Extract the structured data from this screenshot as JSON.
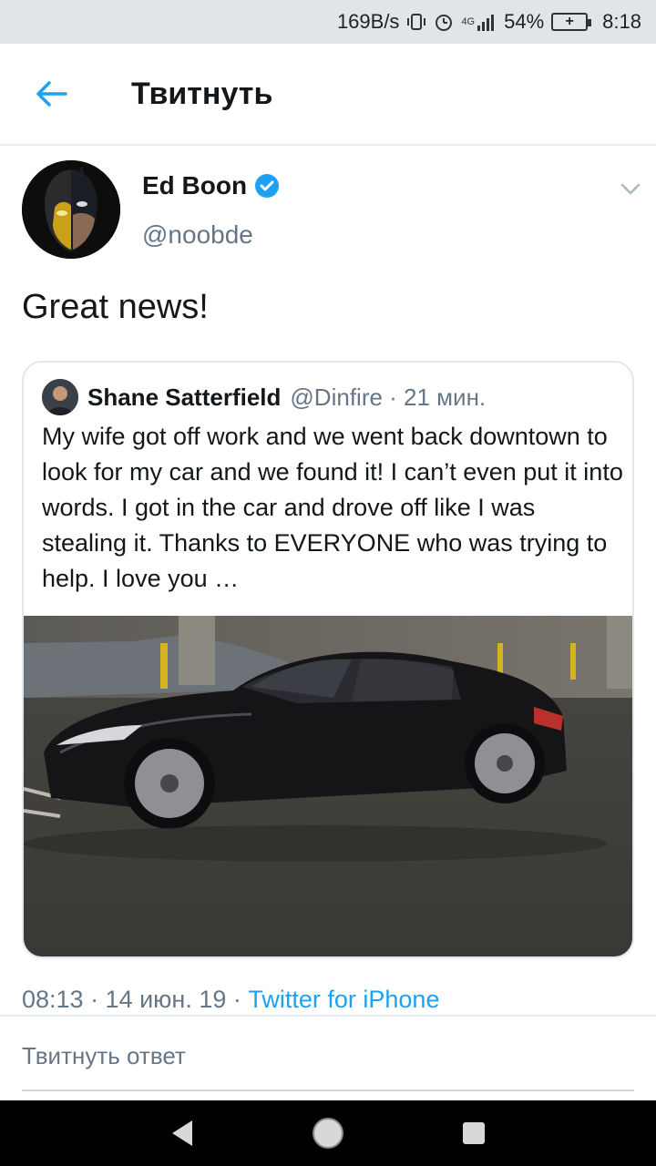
{
  "status_bar": {
    "net_speed": "169B/s",
    "network": "4G",
    "battery": "54%",
    "time": "8:18"
  },
  "app_bar": {
    "title": "Твитнуть"
  },
  "tweet": {
    "author_name": "Ed Boon",
    "author_handle": "@noobde",
    "text": "Great news!",
    "timestamp": "08:13 · 14 июн. 19 · ",
    "source": "Twitter for iPhone"
  },
  "quoted_tweet": {
    "author_name": "Shane Satterfield",
    "meta": "@Dinfire · 21 мин.",
    "text": "My wife got off work and we went back downtown to look for my car and we found it! I can’t even put it into words. I got in the car and drove off like I was stealing it. Thanks to EVERYONE who was trying to help. I love you …"
  },
  "reply": {
    "placeholder": "Твитнуть ответ"
  },
  "colors": {
    "accent": "#1da1f2",
    "secondary_text": "#657786"
  }
}
